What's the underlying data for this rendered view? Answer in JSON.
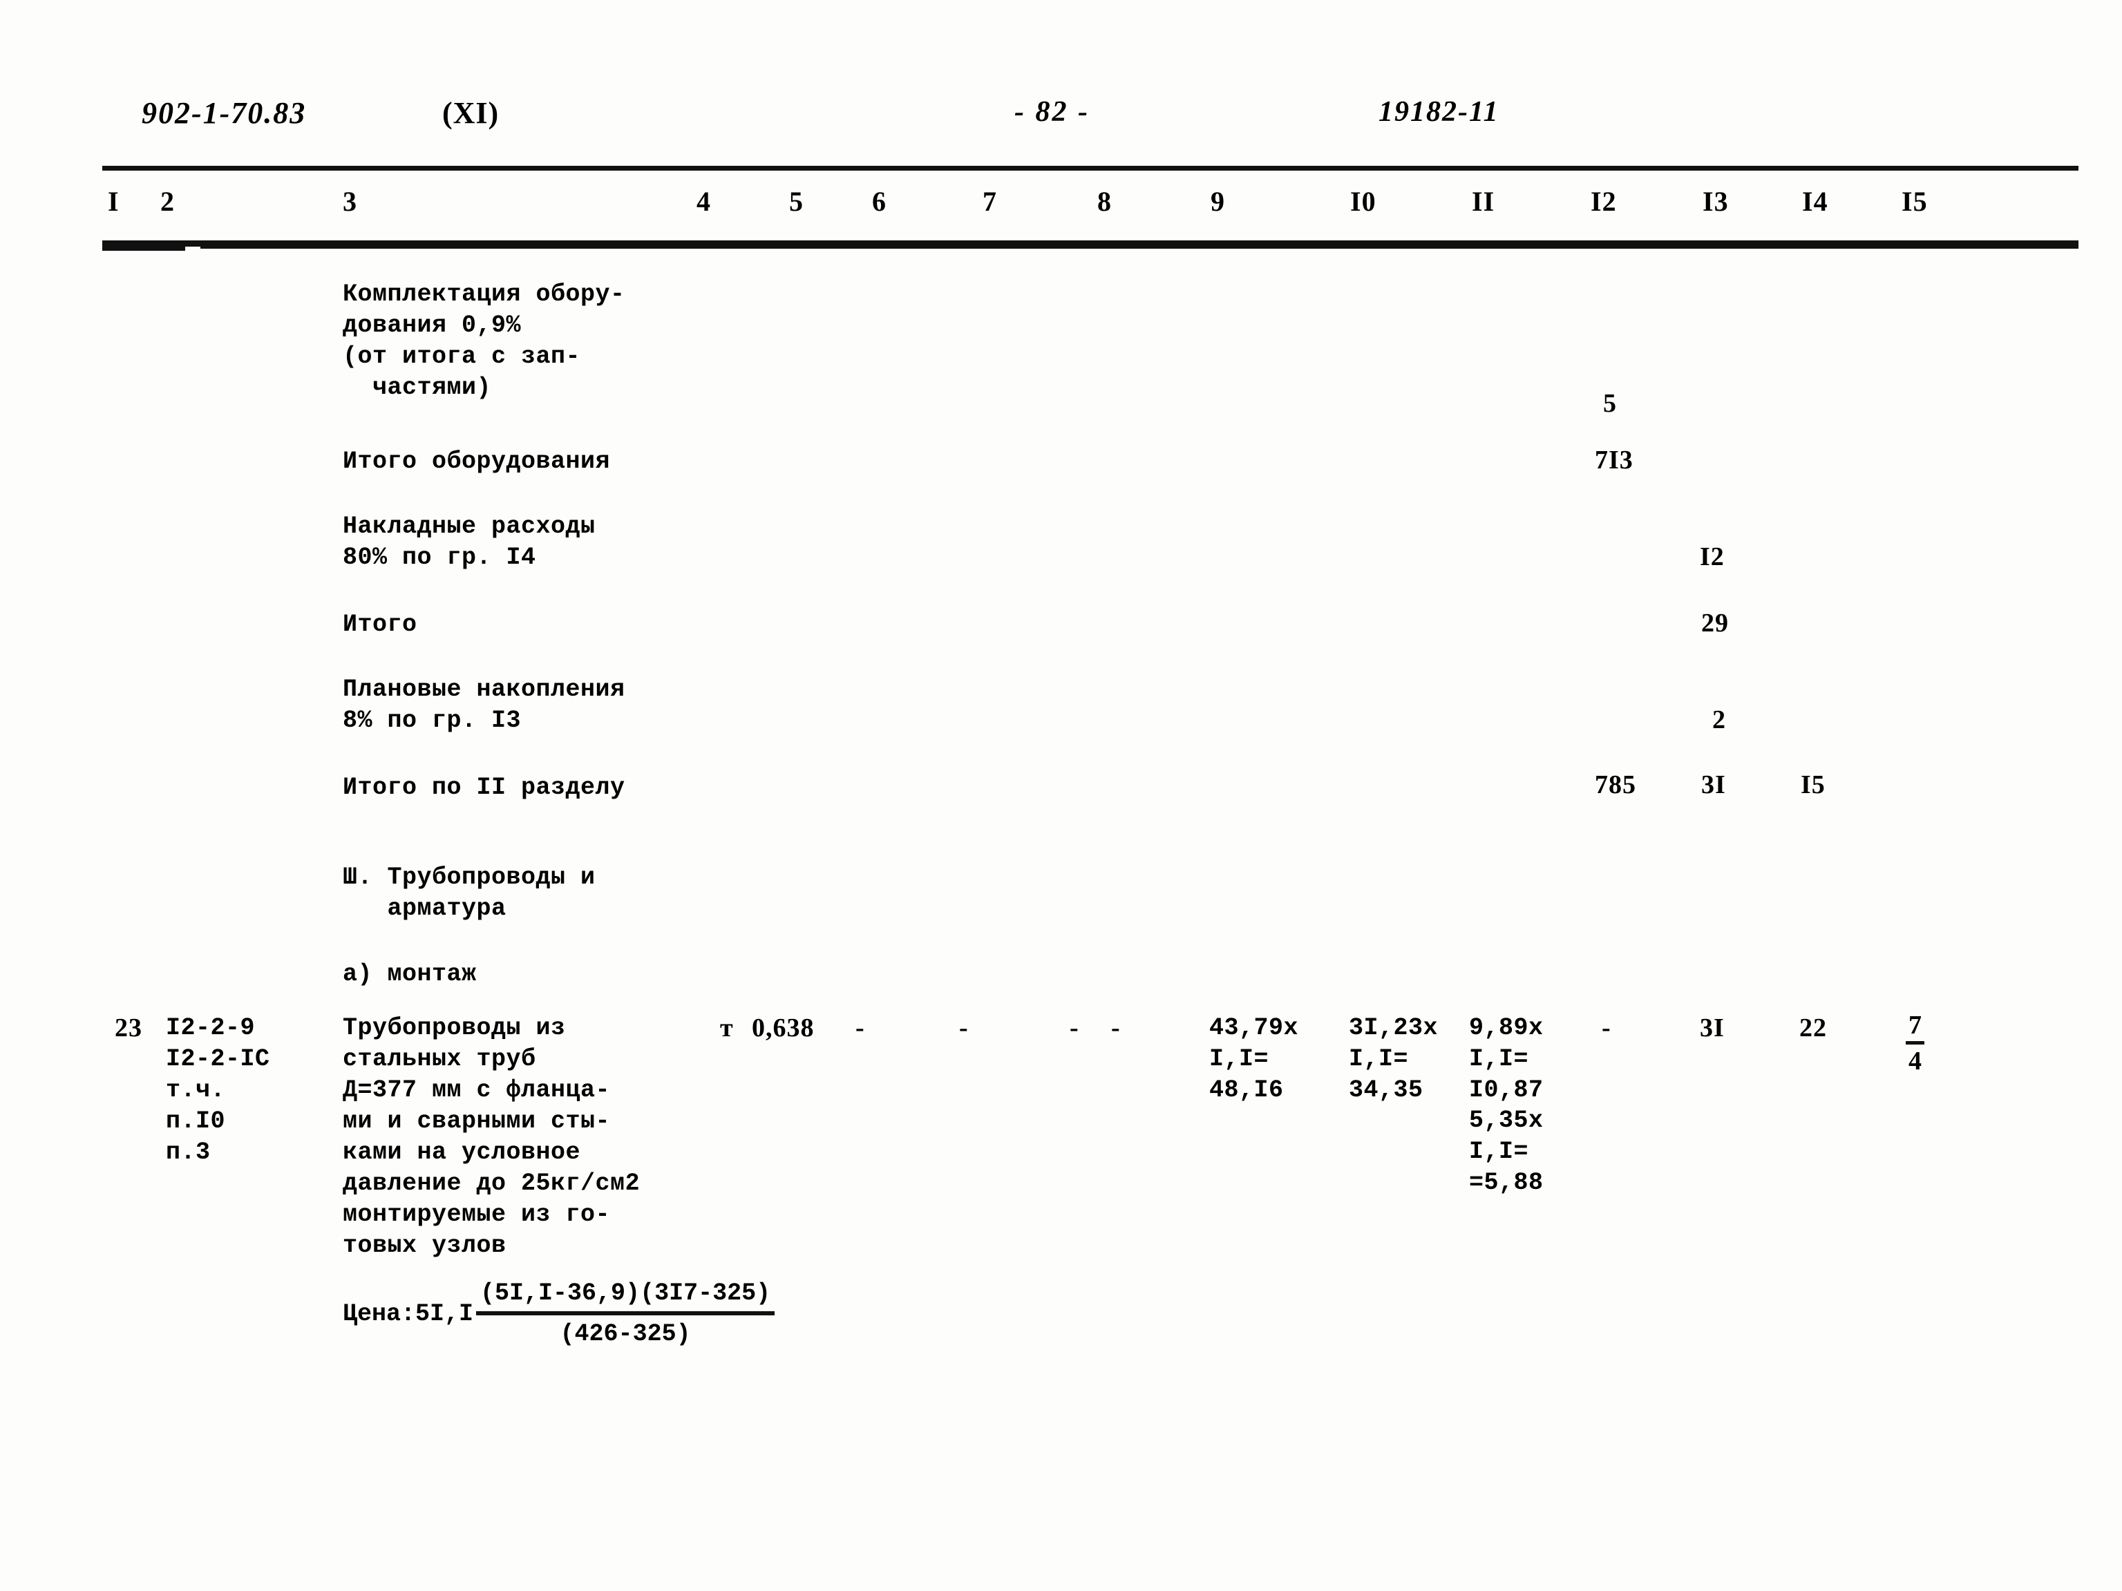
{
  "header": {
    "doc_code": "902-1-70.83",
    "section_code": "(XI)",
    "page_number": "- 82 -",
    "stamp": "19182-11"
  },
  "table": {
    "column_numbers": [
      "I",
      "2",
      "3",
      "4",
      "5",
      "6",
      "7",
      "8",
      "9",
      "I0",
      "II",
      "I2",
      "I3",
      "I4",
      "I5"
    ],
    "rows": [
      {
        "id": "komplektatsiya",
        "description": "Комплектация обору-\nдования 0,9%\n(от итога с зап-\n  частями)",
        "col12": "5"
      },
      {
        "id": "itogo-oborudovaniya",
        "description": "Итого оборудования",
        "col12": "7I3"
      },
      {
        "id": "nakladnye-raskhody",
        "description": "Накладные расходы\n80% по гр. I4",
        "col13": "I2"
      },
      {
        "id": "itogo",
        "description": "Итого",
        "col13": "29"
      },
      {
        "id": "planovye-nakopleniya",
        "description": "Плановые накопления\n8% по гр. I3",
        "col13": "2"
      },
      {
        "id": "itogo-po-razdelu",
        "description": "Итого по II разделу",
        "col12": "785",
        "col13": "3I",
        "col14": "I5"
      }
    ],
    "section_heading": "Ш. Трубопроводы и\n   арматура",
    "subsection_heading": "а) монтаж",
    "work_row": {
      "col1": "23",
      "col2": "I2-2-9\nI2-2-IC\nт.ч.\nп.I0\nп.3",
      "col3": "Трубопроводы из\nстальных труб\nД=377 мм с фланца-\nми и сварными сты-\nками на условное\nдавление до 25кг/см2\nмонтируемые из го-\nтовых узлов",
      "col4_unit": "т",
      "col4_qty": "0,638",
      "col5": "-",
      "col6": "-",
      "col7": "-",
      "col8": "-",
      "col9": "43,79х\nI,I=\n48,I6",
      "col10": "3I,23х\nI,I=\n34,35",
      "col11_a": "9,89х\nI,I=\nI0,87",
      "col11_b": "5,35х\nI,I=\n=5,88",
      "col12": "-",
      "col13": "3I",
      "col14": "22",
      "col15_numerator": "7",
      "col15_denominator": "4"
    },
    "price_formula": {
      "label": "Цена:5I,I",
      "numerator": "(5I,I-36,9)(3I7-325)",
      "denominator": "(426-325)"
    }
  }
}
